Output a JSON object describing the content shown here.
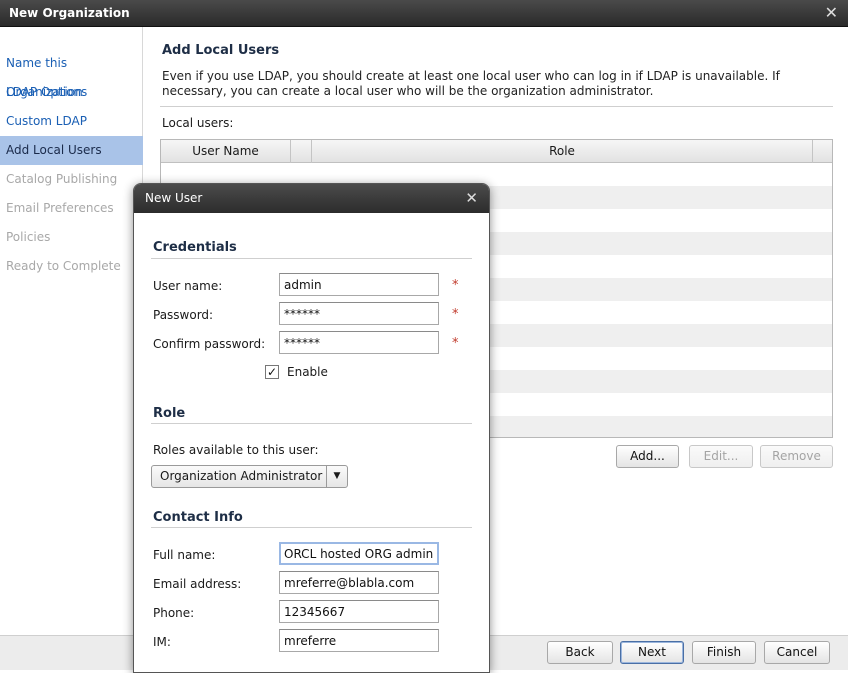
{
  "window": {
    "title": "New Organization",
    "close_glyph": "✕",
    "close_icon": "close-icon"
  },
  "sidebar": {
    "items": [
      {
        "label": "Name this Organization",
        "state": "link"
      },
      {
        "label": "LDAP Options",
        "state": "link"
      },
      {
        "label": "Custom LDAP",
        "state": "link"
      },
      {
        "label": "Add Local Users",
        "state": "active"
      },
      {
        "label": "Catalog Publishing",
        "state": "disabled"
      },
      {
        "label": "Email Preferences",
        "state": "disabled"
      },
      {
        "label": "Policies",
        "state": "disabled"
      },
      {
        "label": "Ready to Complete",
        "state": "disabled"
      }
    ]
  },
  "main": {
    "title": "Add Local Users",
    "description": "Even if you use LDAP, you should create at least one local user who can log in if LDAP is unavailable. If necessary, you can create a local user who will be the organization administrator.",
    "local_users_label": "Local users:",
    "table": {
      "columns": [
        "User Name",
        "Role"
      ]
    },
    "buttons": {
      "add": "Add...",
      "edit": "Edit...",
      "remove": "Remove"
    }
  },
  "footer": {
    "back": "Back",
    "next": "Next",
    "finish": "Finish",
    "cancel": "Cancel"
  },
  "modal": {
    "title": "New User",
    "close_glyph": "✕",
    "credentials": {
      "heading": "Credentials",
      "username_label": "User name:",
      "username_value": "admin",
      "password_label": "Password:",
      "password_value": "******",
      "confirm_label": "Confirm password:",
      "confirm_value": "******",
      "required_mark": "*",
      "enable_label": "Enable",
      "enable_checked": true,
      "check_glyph": "✓"
    },
    "role": {
      "heading": "Role",
      "available_label": "Roles available to this user:",
      "selected": "Organization Administrator",
      "arrow_glyph": "▼"
    },
    "contact": {
      "heading": "Contact Info",
      "fullname_label": "Full name:",
      "fullname_value": "ORCL hosted ORG admin",
      "email_label": "Email address:",
      "email_value": "mreferre@blabla.com",
      "phone_label": "Phone:",
      "phone_value": "12345667",
      "im_label": "IM:",
      "im_value": "mreferre"
    }
  },
  "colors": {
    "accent": "#a9c3e8",
    "link": "#1a5fb4",
    "required": "#c0392b",
    "titlebar": "#2c2c2c"
  }
}
